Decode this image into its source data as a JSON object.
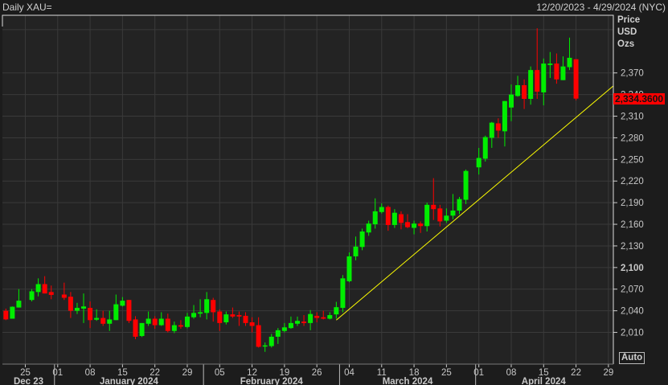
{
  "header": {
    "title": "Daily XAU=",
    "range": "12/20/2023 - 4/29/2024 (NYC)"
  },
  "axis_units": [
    "Price",
    "USD",
    "Ozs"
  ],
  "auto_button": "Auto",
  "last_price_label": "2,334.3600",
  "colors": {
    "up": "#00ee00",
    "down": "#ff0000",
    "trendline": "#ffff00",
    "grid": "#3a3a3a",
    "plot_bg": "#232323"
  },
  "chart_data": {
    "type": "candlestick",
    "title": "Daily XAU=",
    "ylabel": "Price USD Ozs",
    "ylim": [
      1966,
      2450
    ],
    "xlim": [
      "2023-12-20",
      "2024-04-29"
    ],
    "grid": true,
    "y_ticks": [
      2010,
      2040,
      2070,
      2100,
      2130,
      2160,
      2190,
      2220,
      2250,
      2280,
      2310,
      2340,
      2370
    ],
    "y_tick_labels": [
      "2,010",
      "2,040",
      "2,070",
      "2,100",
      "2,130",
      "2,160",
      "2,190",
      "2,220",
      "2,250",
      "2,280",
      "2,310",
      "2,340",
      "2,370"
    ],
    "y_bold_tick": 2100,
    "x_ticks": [
      {
        "date": "2023-12-25",
        "label": "25"
      },
      {
        "date": "2024-01-01",
        "label": "01"
      },
      {
        "date": "2024-01-08",
        "label": "08"
      },
      {
        "date": "2024-01-15",
        "label": "15"
      },
      {
        "date": "2024-01-22",
        "label": "22"
      },
      {
        "date": "2024-01-29",
        "label": "29"
      },
      {
        "date": "2024-02-05",
        "label": "05"
      },
      {
        "date": "2024-02-12",
        "label": "12"
      },
      {
        "date": "2024-02-19",
        "label": "19"
      },
      {
        "date": "2024-02-26",
        "label": "26"
      },
      {
        "date": "2024-03-04",
        "label": "04"
      },
      {
        "date": "2024-03-11",
        "label": "11"
      },
      {
        "date": "2024-03-18",
        "label": "18"
      },
      {
        "date": "2024-03-25",
        "label": "25"
      },
      {
        "date": "2024-04-01",
        "label": "01"
      },
      {
        "date": "2024-04-08",
        "label": "08"
      },
      {
        "date": "2024-04-15",
        "label": "15"
      },
      {
        "date": "2024-04-22",
        "label": "22"
      },
      {
        "date": "2024-04-29",
        "label": "29"
      }
    ],
    "months": [
      {
        "label": "Dec 23",
        "start": "2023-12-20",
        "end": "2023-12-29"
      },
      {
        "label": "January 2024",
        "start": "2024-01-01",
        "end": "2024-01-31"
      },
      {
        "label": "February 2024",
        "start": "2024-02-01",
        "end": "2024-02-29"
      },
      {
        "label": "March 2024",
        "start": "2024-03-01",
        "end": "2024-03-29"
      },
      {
        "label": "April 2024",
        "start": "2024-04-01",
        "end": "2024-04-29"
      }
    ],
    "candles": [
      [
        "2023-12-20",
        2040,
        2043,
        2027,
        2028
      ],
      [
        "2023-12-21",
        2029,
        2046,
        2029,
        2045.6
      ],
      [
        "2023-12-22",
        2044.5,
        2070,
        2044.5,
        2054
      ],
      [
        "2023-12-26",
        2055,
        2070,
        2053,
        2067
      ],
      [
        "2023-12-27",
        2066,
        2085,
        2060,
        2077
      ],
      [
        "2023-12-28",
        2077,
        2088,
        2064,
        2064
      ],
      [
        "2023-12-29",
        2066,
        2075,
        2056,
        2062
      ],
      [
        "2024-01-02",
        2062.5,
        2079,
        2055,
        2058
      ],
      [
        "2024-01-03",
        2059.5,
        2066,
        2030,
        2040
      ],
      [
        "2024-01-04",
        2040,
        2051,
        2035.5,
        2044
      ],
      [
        "2024-01-05",
        2043,
        2064,
        2023,
        2046
      ],
      [
        "2024-01-08",
        2044,
        2053,
        2016,
        2027
      ],
      [
        "2024-01-09",
        2027.6,
        2042,
        2026,
        2030
      ],
      [
        "2024-01-10",
        2030,
        2040,
        2019,
        2022
      ],
      [
        "2024-01-11",
        2022,
        2040,
        2012,
        2028
      ],
      [
        "2024-01-12",
        2027,
        2062.5,
        2027,
        2049
      ],
      [
        "2024-01-15",
        2047,
        2059,
        2046,
        2054
      ],
      [
        "2024-01-16",
        2055,
        2055,
        2023,
        2026
      ],
      [
        "2024-01-17",
        2028,
        2032.5,
        2000.6,
        2004
      ],
      [
        "2024-01-18",
        2005,
        2023,
        2003.6,
        2023
      ],
      [
        "2024-01-19",
        2022,
        2039,
        2019,
        2029
      ],
      [
        "2024-01-22",
        2029,
        2032.5,
        2015,
        2020
      ],
      [
        "2024-01-23",
        2020,
        2038,
        2019,
        2029
      ],
      [
        "2024-01-24",
        2029,
        2036,
        2010,
        2012
      ],
      [
        "2024-01-25",
        2012,
        2025,
        2009,
        2020
      ],
      [
        "2024-01-26",
        2020,
        2027,
        2015,
        2018
      ],
      [
        "2024-01-29",
        2017.5,
        2037,
        2015.6,
        2032
      ],
      [
        "2024-01-30",
        2031,
        2048,
        2029,
        2037
      ],
      [
        "2024-01-31",
        2036,
        2056,
        2031,
        2038
      ],
      [
        "2024-02-01",
        2037,
        2066,
        2028,
        2056
      ],
      [
        "2024-02-02",
        2055,
        2058,
        2025,
        2038
      ],
      [
        "2024-02-05",
        2039,
        2042,
        2012,
        2023
      ],
      [
        "2024-02-06",
        2024,
        2039,
        2021,
        2035
      ],
      [
        "2024-02-07",
        2035,
        2044.5,
        2030,
        2032
      ],
      [
        "2024-02-08",
        2034,
        2039,
        2019,
        2032
      ],
      [
        "2024-02-09",
        2033,
        2038,
        2019,
        2023
      ],
      [
        "2024-02-12",
        2024,
        2031,
        2010,
        2019
      ],
      [
        "2024-02-13",
        2020,
        2031,
        1989,
        1990
      ],
      [
        "2024-02-14",
        1991.5,
        1996,
        1983,
        1992
      ],
      [
        "2024-02-15",
        1991,
        2008,
        1989,
        2004
      ],
      [
        "2024-02-16",
        2004,
        2016,
        1994,
        2013
      ],
      [
        "2024-02-19",
        2012,
        2023,
        2010,
        2017
      ],
      [
        "2024-02-20",
        2016,
        2032,
        2015,
        2023
      ],
      [
        "2024-02-21",
        2022,
        2032,
        2019,
        2026
      ],
      [
        "2024-02-22",
        2025,
        2034,
        2019,
        2023
      ],
      [
        "2024-02-23",
        2023,
        2041,
        2013,
        2035.5
      ],
      [
        "2024-02-26",
        2033,
        2038,
        2024,
        2030
      ],
      [
        "2024-02-27",
        2031,
        2040,
        2028,
        2029
      ],
      [
        "2024-02-28",
        2029,
        2038,
        2028,
        2034
      ],
      [
        "2024-02-29",
        2035,
        2052.4,
        2029,
        2045
      ],
      [
        "2024-03-01",
        2044,
        2089.5,
        2038,
        2085
      ],
      [
        "2024-03-04",
        2081,
        2121,
        2079.5,
        2115.5
      ],
      [
        "2024-03-05",
        2115.5,
        2143,
        2110,
        2129
      ],
      [
        "2024-03-06",
        2128.5,
        2154,
        2124,
        2150
      ],
      [
        "2024-03-07",
        2148.6,
        2165,
        2144,
        2161
      ],
      [
        "2024-03-08",
        2160,
        2196,
        2154,
        2178
      ],
      [
        "2024-03-11",
        2177,
        2189,
        2175,
        2184
      ],
      [
        "2024-03-12",
        2184,
        2186,
        2151,
        2159
      ],
      [
        "2024-03-13",
        2159,
        2181,
        2155,
        2176
      ],
      [
        "2024-03-14",
        2174,
        2178,
        2153,
        2162
      ],
      [
        "2024-03-15",
        2163,
        2174,
        2154.6,
        2156
      ],
      [
        "2024-03-18",
        2155,
        2165,
        2146,
        2161
      ],
      [
        "2024-03-19",
        2161,
        2164,
        2148,
        2157.5
      ],
      [
        "2024-03-20",
        2157.5,
        2190,
        2150,
        2187
      ],
      [
        "2024-03-21",
        2187,
        2224,
        2166,
        2181
      ],
      [
        "2024-03-22",
        2182,
        2187,
        2157,
        2164
      ],
      [
        "2024-03-25",
        2165,
        2182,
        2162,
        2172
      ],
      [
        "2024-03-26",
        2172,
        2202,
        2167,
        2179
      ],
      [
        "2024-03-27",
        2179,
        2198,
        2174,
        2195
      ],
      [
        "2024-03-28",
        2194,
        2236,
        2188,
        2234
      ],
      [
        "2024-04-01",
        2239,
        2266,
        2229,
        2252
      ],
      [
        "2024-04-02",
        2251,
        2283,
        2247,
        2281
      ],
      [
        "2024-04-03",
        2280,
        2302,
        2266,
        2301
      ],
      [
        "2024-04-04",
        2300,
        2307,
        2280,
        2290
      ],
      [
        "2024-04-05",
        2289,
        2331,
        2268,
        2331
      ],
      [
        "2024-04-08",
        2322,
        2354,
        2303,
        2340
      ],
      [
        "2024-04-09",
        2338,
        2366,
        2337,
        2353
      ],
      [
        "2024-04-10",
        2353,
        2361,
        2320,
        2334
      ],
      [
        "2024-04-11",
        2334,
        2379,
        2326,
        2374
      ],
      [
        "2024-04-12",
        2374,
        2432,
        2334,
        2344
      ],
      [
        "2024-04-15",
        2343,
        2390,
        2325,
        2383
      ],
      [
        "2024-04-16",
        2381,
        2399,
        2363,
        2383
      ],
      [
        "2024-04-17",
        2383,
        2397,
        2355,
        2361
      ],
      [
        "2024-04-18",
        2360,
        2393,
        2360,
        2379
      ],
      [
        "2024-04-19",
        2378,
        2419,
        2374,
        2391
      ],
      [
        "2024-04-22",
        2389,
        2389,
        2332,
        2334.36
      ]
    ],
    "last_price": 2334.36,
    "trendline": {
      "start": {
        "date": "2024-02-29",
        "price": 2027
      },
      "end": {
        "date": "2024-05-01",
        "price": 2352
      }
    }
  }
}
